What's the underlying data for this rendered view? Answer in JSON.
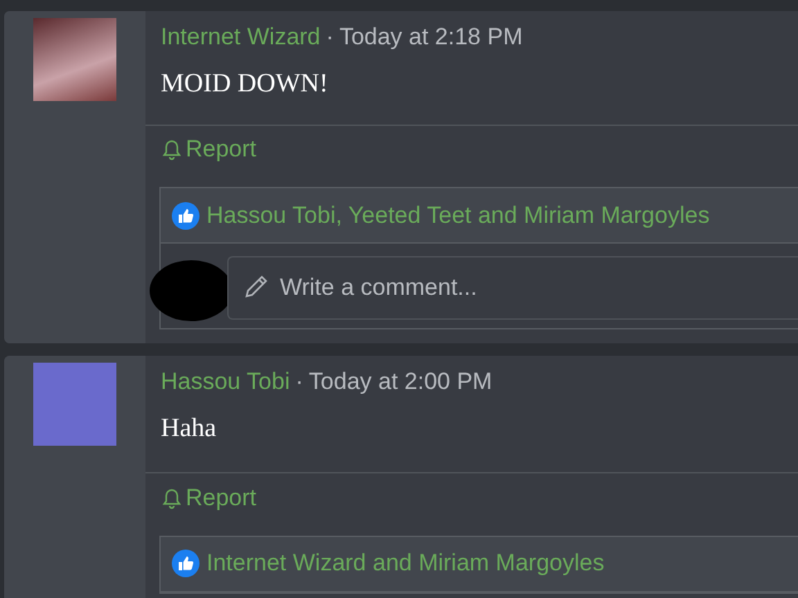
{
  "posts": [
    {
      "author": "Internet Wizard",
      "separator": "·",
      "time": "Today at 2:18 PM",
      "message": "MOID DOWN!",
      "report": "Report",
      "likes": "Hassou Tobi, Yeeted Teet and Miriam Margoyles",
      "comment": {
        "placeholder": "Write a comment..."
      }
    },
    {
      "author": "Hassou Tobi",
      "separator": "·",
      "time": "Today at 2:00 PM",
      "message": "Haha",
      "report": "Report",
      "likes": "Internet Wizard and Miriam Margoyles"
    }
  ]
}
